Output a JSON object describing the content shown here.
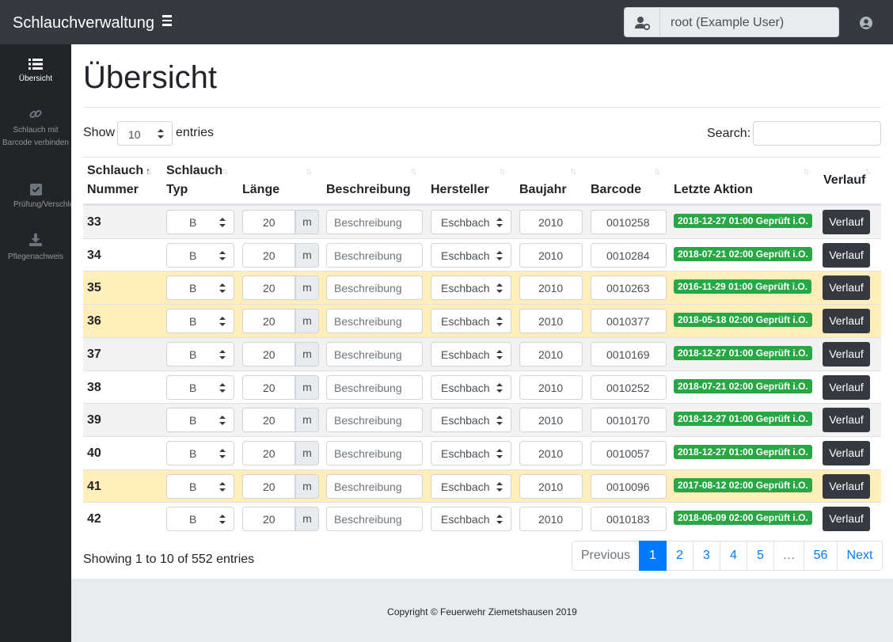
{
  "app": {
    "title": "Schlauchverwaltung",
    "user": "root (Example User)"
  },
  "sidebar": {
    "items": [
      {
        "label": "Übersicht",
        "icon": "list-icon",
        "active": true
      },
      {
        "label": "Schlauch mit Barcode verbinden",
        "icon": "link-icon",
        "active": false
      },
      {
        "label": "Prüfung/Verschleiß",
        "icon": "check-square-icon",
        "active": false
      },
      {
        "label": "Pflegenachweis",
        "icon": "download-icon",
        "active": false
      }
    ]
  },
  "page": {
    "title": "Übersicht"
  },
  "table_controls": {
    "show": "Show",
    "length": "10",
    "entries": "entries",
    "search_label": "Search:",
    "search_value": ""
  },
  "columns": [
    "Schlauch Nummer",
    "Schlauch Typ",
    "Länge",
    "Beschreibung",
    "Hersteller",
    "Baujahr",
    "Barcode",
    "Letzte Aktion",
    "Verlauf"
  ],
  "rows": [
    {
      "nummer": "33",
      "typ": "B",
      "laenge": "20",
      "einheit": "m",
      "beschreibung": "Beschreibung",
      "hersteller": "Eschbach",
      "baujahr": "2010",
      "barcode": "0010258",
      "aktion": "2018-12-27 01:00 Geprüft i.O.",
      "verlauf": "Verlauf",
      "state": "striped"
    },
    {
      "nummer": "34",
      "typ": "B",
      "laenge": "20",
      "einheit": "m",
      "beschreibung": "Beschreibung",
      "hersteller": "Eschbach",
      "baujahr": "2010",
      "barcode": "0010284",
      "aktion": "2018-07-21 02:00 Geprüft i.O.",
      "verlauf": "Verlauf",
      "state": "plain"
    },
    {
      "nummer": "35",
      "typ": "B",
      "laenge": "20",
      "einheit": "m",
      "beschreibung": "Beschreibung",
      "hersteller": "Eschbach",
      "baujahr": "2010",
      "barcode": "0010263",
      "aktion": "2016-11-29 01:00 Geprüft i.O.",
      "verlauf": "Verlauf",
      "state": "warning"
    },
    {
      "nummer": "36",
      "typ": "B",
      "laenge": "20",
      "einheit": "m",
      "beschreibung": "Beschreibung",
      "hersteller": "Eschbach",
      "baujahr": "2010",
      "barcode": "0010377",
      "aktion": "2018-05-18 02:00 Geprüft i.O.",
      "verlauf": "Verlauf",
      "state": "warning"
    },
    {
      "nummer": "37",
      "typ": "B",
      "laenge": "20",
      "einheit": "m",
      "beschreibung": "Beschreibung",
      "hersteller": "Eschbach",
      "baujahr": "2010",
      "barcode": "0010169",
      "aktion": "2018-12-27 01:00 Geprüft i.O.",
      "verlauf": "Verlauf",
      "state": "striped"
    },
    {
      "nummer": "38",
      "typ": "B",
      "laenge": "20",
      "einheit": "m",
      "beschreibung": "Beschreibung",
      "hersteller": "Eschbach",
      "baujahr": "2010",
      "barcode": "0010252",
      "aktion": "2018-07-21 02:00 Geprüft i.O.",
      "verlauf": "Verlauf",
      "state": "plain"
    },
    {
      "nummer": "39",
      "typ": "B",
      "laenge": "20",
      "einheit": "m",
      "beschreibung": "Beschreibung",
      "hersteller": "Eschbach",
      "baujahr": "2010",
      "barcode": "0010170",
      "aktion": "2018-12-27 01:00 Geprüft i.O.",
      "verlauf": "Verlauf",
      "state": "striped"
    },
    {
      "nummer": "40",
      "typ": "B",
      "laenge": "20",
      "einheit": "m",
      "beschreibung": "Beschreibung",
      "hersteller": "Eschbach",
      "baujahr": "2010",
      "barcode": "0010057",
      "aktion": "2018-12-27 01:00 Geprüft i.O.",
      "verlauf": "Verlauf",
      "state": "plain"
    },
    {
      "nummer": "41",
      "typ": "B",
      "laenge": "20",
      "einheit": "m",
      "beschreibung": "Beschreibung",
      "hersteller": "Eschbach",
      "baujahr": "2010",
      "barcode": "0010096",
      "aktion": "2017-08-12 02:00 Geprüft i.O.",
      "verlauf": "Verlauf",
      "state": "warning"
    },
    {
      "nummer": "42",
      "typ": "B",
      "laenge": "20",
      "einheit": "m",
      "beschreibung": "Beschreibung",
      "hersteller": "Eschbach",
      "baujahr": "2010",
      "barcode": "0010183",
      "aktion": "2018-06-09 02:00 Geprüft i.O.",
      "verlauf": "Verlauf",
      "state": "plain"
    }
  ],
  "info": "Showing 1 to 10 of 552 entries",
  "pagination": {
    "previous": "Previous",
    "pages": [
      "1",
      "2",
      "3",
      "4",
      "5",
      "…",
      "56"
    ],
    "current": "1",
    "next": "Next"
  },
  "footer": {
    "copyright": "Copyright © Feuerwehr Ziemetshausen 2019"
  },
  "colors": {
    "navbar": "#343a40",
    "sidebar": "#212529",
    "badge_success": "#28a745",
    "row_warning": "#ffeeba",
    "primary": "#007bff"
  }
}
